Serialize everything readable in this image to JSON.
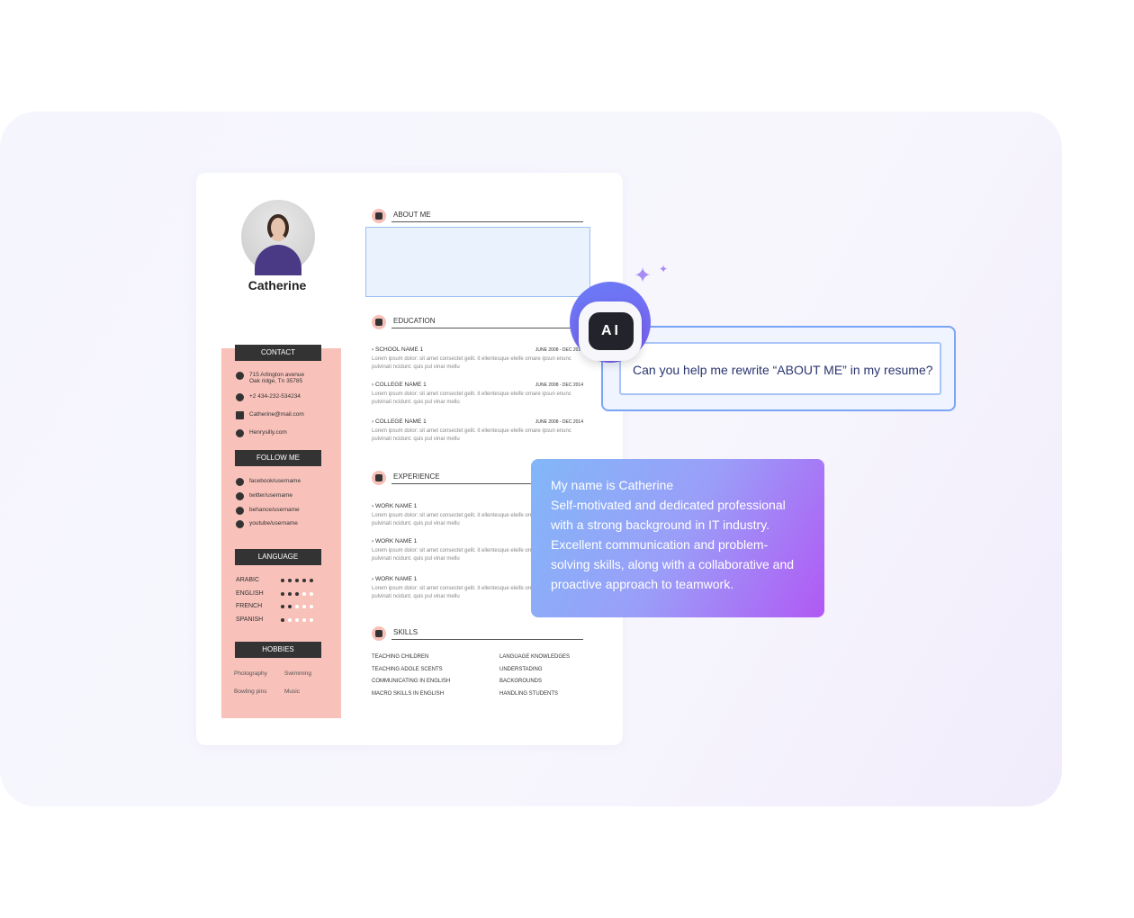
{
  "resume": {
    "name": "Catherine",
    "contact": {
      "title": "CONTACT",
      "address": [
        "715 Arlington avenue",
        "Oak ridge, Tn 35785"
      ],
      "phone": "+2 434-232-534234",
      "email": "Catherine@mail.com",
      "website": "Henrysilly.com"
    },
    "follow": {
      "title": "FOLLOW ME",
      "items": [
        "facebook/username",
        "twitter/username",
        "behance/username",
        "youtube/username"
      ]
    },
    "language": {
      "title": "LANGUAGE",
      "items": [
        {
          "name": "ARABIC",
          "level": 5
        },
        {
          "name": "ENGLISH",
          "level": 3
        },
        {
          "name": "FRENCH",
          "level": 2
        },
        {
          "name": "SPANISH",
          "level": 1
        }
      ],
      "max": 5
    },
    "hobbies": {
      "title": "HOBBIES",
      "items": [
        "Photography",
        "Swimming",
        "Bowling pins",
        "Music"
      ]
    },
    "about": {
      "title": "ABOUT ME"
    },
    "education": {
      "title": "EDUCATION",
      "items": [
        {
          "name": "SCHOOL NAME 1",
          "date": "JUNE 2008 - DEC 2014",
          "text": "Lorem ipsum dolor: sit amet consectet gelit. it ellentesque eleife ornare ipsun enunc pulvinati ncidunt. quis pul vinar mellu"
        },
        {
          "name": "COLLEGE NAME 1",
          "date": "JUNE 2008 - DEC 2014",
          "text": "Lorem ipsum dolor: sit amet consectet gelit. it ellentesque eleife ornare ipsun enunc pulvinati ncidunt. quis pul vinar mellu"
        },
        {
          "name": "COLLEGE NAME 1",
          "date": "JUNE 2008 - DEC 2014",
          "text": "Lorem ipsum dolor: sit amet consectet gelit. it ellentesque eleife ornare ipsun enunc pulvinati ncidunt. quis pul vinar mellu"
        }
      ]
    },
    "experience": {
      "title": "EXPERIENCE",
      "items": [
        {
          "name": "WORK NAME 1",
          "text": "Lorem ipsum dolor: sit amet consectet gelit. it ellentesque eleife ornare ipsun enunc pulvinati ncidunt. quis pul vinar mellu"
        },
        {
          "name": "WORK NAME 1",
          "text": "Lorem ipsum dolor: sit amet consectet gelit. it ellentesque eleife ornare ipsun enunc pulvinati ncidunt. quis pul vinar mellu"
        },
        {
          "name": "WORK NAME 1",
          "text": "Lorem ipsum dolor: sit amet consectet gelit. it ellentesque eleife ornare ipsun enunc pulvinati ncidunt. quis pul vinar mellu"
        }
      ]
    },
    "skills": {
      "title": "SKILLS",
      "left": [
        "TEACHING CHILDREN",
        "TEACHING ADOLE SCENTS",
        "COMMUNICATING IN ENGLISH",
        "MACRO SKILLS IN ENGLISH"
      ],
      "right": [
        "LANGUAGE KNOWLEDGES",
        "UNDERSTADING",
        "BACKGROUNDS",
        "HANDLING STUDENTS"
      ]
    }
  },
  "ai": {
    "badge": "AI",
    "prompt": "Can you help me rewrite “ABOUT ME” in my resume?",
    "reply": [
      "My name is Catherine",
      "Self-motivated and dedicated professional with a strong background in IT industry.",
      "Excellent communication and problem-solving skills, along with a collaborative and proactive approach to teamwork."
    ]
  },
  "colors": {
    "sidebar": "#f8c1ba",
    "accent": "#7a5ef0",
    "bar": "#333333"
  }
}
